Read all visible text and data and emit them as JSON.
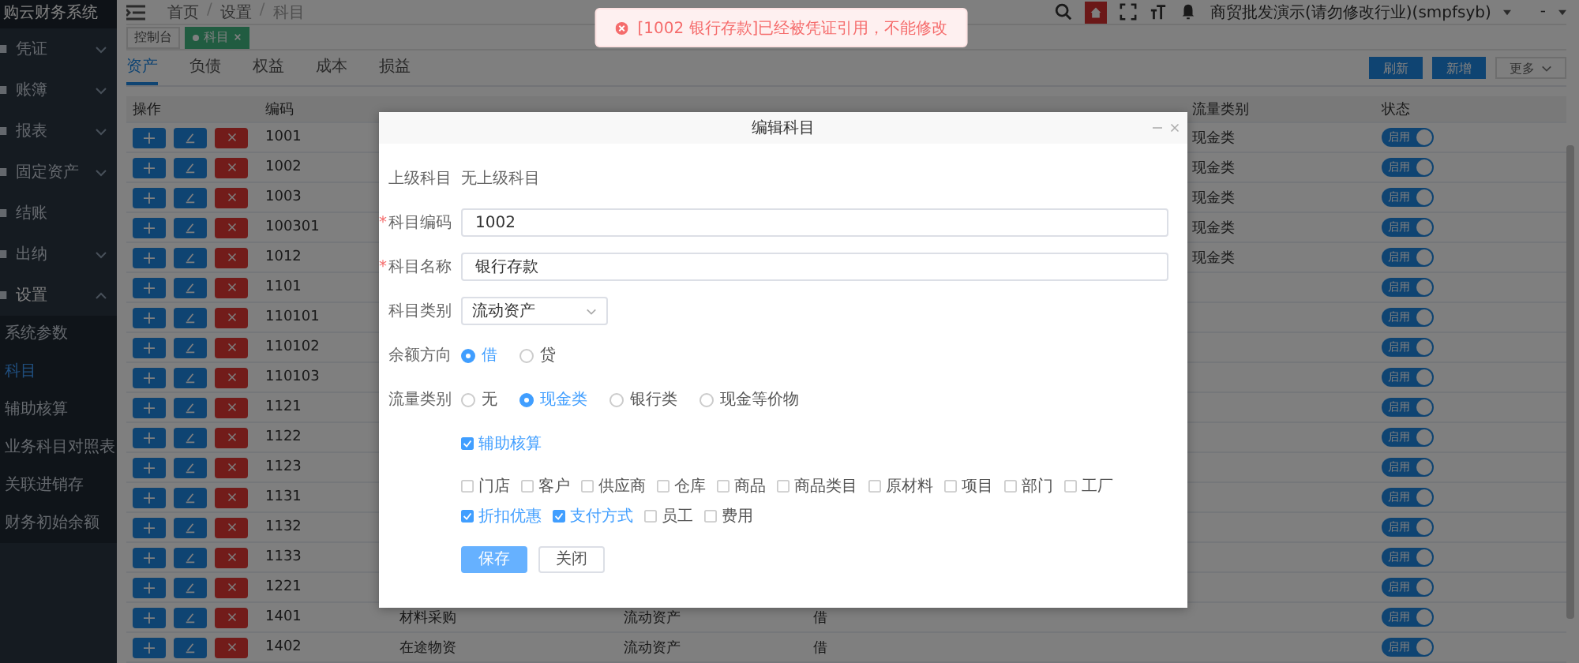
{
  "sidebar": {
    "title": "购云财务系统",
    "items": [
      {
        "label": "凭证",
        "kind": "group",
        "expanded": false
      },
      {
        "label": "账簿",
        "kind": "group",
        "expanded": false
      },
      {
        "label": "报表",
        "kind": "group",
        "expanded": false
      },
      {
        "label": "固定资产",
        "kind": "group",
        "expanded": false
      },
      {
        "label": "结账",
        "kind": "link"
      },
      {
        "label": "出纳",
        "kind": "group",
        "expanded": false
      },
      {
        "label": "设置",
        "kind": "group",
        "expanded": true,
        "children": [
          {
            "label": "系统参数",
            "selected": false
          },
          {
            "label": "科目",
            "selected": true
          },
          {
            "label": "辅助核算",
            "selected": false
          },
          {
            "label": "业务科目对照表",
            "selected": false
          },
          {
            "label": "关联进销存",
            "selected": false
          },
          {
            "label": "财务初始余额",
            "selected": false
          }
        ]
      }
    ]
  },
  "breadcrumb": [
    {
      "label": "首页",
      "kind": "link"
    },
    {
      "label": "/",
      "kind": "separator"
    },
    {
      "label": "设置",
      "kind": "link"
    },
    {
      "label": "/",
      "kind": "separator"
    },
    {
      "label": "科目",
      "kind": "current"
    }
  ],
  "user": {
    "name": "商贸批发演示(请勿修改行业)(smpfsyb)",
    "extra": "-"
  },
  "page_tags": [
    {
      "label": "控制台",
      "selected": false
    },
    {
      "label": "科目",
      "selected": true
    }
  ],
  "tabs": [
    {
      "label": "资产",
      "selected": true
    },
    {
      "label": "负债",
      "selected": false
    },
    {
      "label": "权益",
      "selected": false
    },
    {
      "label": "成本",
      "selected": false
    },
    {
      "label": "损益",
      "selected": false
    }
  ],
  "toolbar": [
    {
      "label": "刷新",
      "kind": "primary"
    },
    {
      "label": "新增",
      "kind": "primary"
    },
    {
      "label": "更多",
      "kind": "dropdown"
    }
  ],
  "table": {
    "header": {
      "actions": "操作",
      "code": "编码",
      "flow": "流量类别",
      "status": "状态"
    },
    "rows": [
      {
        "code": "1001",
        "flow": "现金类",
        "status": "启用",
        "enabled": true
      },
      {
        "code": "1002",
        "flow": "现金类",
        "status": "启用",
        "enabled": true
      },
      {
        "code": "1003",
        "flow": "现金类",
        "status": "启用",
        "enabled": true
      },
      {
        "code": "100301",
        "flow": "现金类",
        "status": "启用",
        "enabled": true
      },
      {
        "code": "1012",
        "flow": "现金类",
        "status": "启用",
        "enabled": true
      },
      {
        "code": "1101",
        "status": "启用",
        "enabled": true
      },
      {
        "code": "110101",
        "status": "启用",
        "enabled": true
      },
      {
        "code": "110102",
        "status": "启用",
        "enabled": true
      },
      {
        "code": "110103",
        "status": "启用",
        "enabled": true
      },
      {
        "code": "1121",
        "status": "启用",
        "enabled": true
      },
      {
        "code": "1122",
        "status": "启用",
        "enabled": true
      },
      {
        "code": "1123",
        "status": "启用",
        "enabled": true
      },
      {
        "code": "1131",
        "status": "启用",
        "enabled": true
      },
      {
        "code": "1132",
        "status": "启用",
        "enabled": true
      },
      {
        "code": "1133",
        "status": "启用",
        "enabled": true
      },
      {
        "code": "1221",
        "status": "启用",
        "enabled": true
      },
      {
        "code": "1401",
        "name": "材料采购",
        "category": "流动资产",
        "direction": "借",
        "status": "启用",
        "enabled": true
      },
      {
        "code": "1402",
        "name": "在途物资",
        "category": "流动资产",
        "direction": "借",
        "status": "启用",
        "enabled": true
      }
    ]
  },
  "dialog": {
    "title": "编辑科目",
    "parent": {
      "label": "上级科目",
      "value": "无上级科目"
    },
    "fields": [
      {
        "label": "科目编码",
        "marker": "*",
        "value": "1002"
      },
      {
        "label": "科目名称",
        "marker": "*",
        "value": "银行存款"
      }
    ],
    "category": {
      "label": "科目类别",
      "value": "流动资产"
    },
    "radio_groups": [
      {
        "label": "余额方向",
        "options": [
          {
            "label": "借",
            "selected": true
          },
          {
            "label": "贷",
            "selected": false
          }
        ]
      },
      {
        "label": "流量类别",
        "options": [
          {
            "label": "无",
            "selected": false
          },
          {
            "label": "现金类",
            "selected": true
          },
          {
            "label": "银行类",
            "selected": false
          },
          {
            "label": "现金等价物",
            "selected": false
          }
        ]
      }
    ],
    "aux": {
      "label": "辅助核算",
      "checked": true
    },
    "aux_rows": [
      [
        {
          "label": "门店",
          "checked": false
        },
        {
          "label": "客户",
          "checked": false
        },
        {
          "label": "供应商",
          "checked": false
        },
        {
          "label": "仓库",
          "checked": false
        },
        {
          "label": "商品",
          "checked": false
        },
        {
          "label": "商品类目",
          "checked": false
        },
        {
          "label": "原材料",
          "checked": false
        },
        {
          "label": "项目",
          "checked": false
        },
        {
          "label": "部门",
          "checked": false
        },
        {
          "label": "工厂",
          "checked": false
        }
      ],
      [
        {
          "label": "折扣优惠",
          "checked": true
        },
        {
          "label": "支付方式",
          "checked": true
        },
        {
          "label": "员工",
          "checked": false
        },
        {
          "label": "费用",
          "checked": false
        }
      ]
    ],
    "buttons": [
      {
        "label": "保存",
        "kind": "primary"
      },
      {
        "label": "关闭",
        "kind": "default"
      }
    ]
  },
  "toast": {
    "kind": "error",
    "text": "[1002 银行存款]已经被凭证引用，不能修改"
  }
}
